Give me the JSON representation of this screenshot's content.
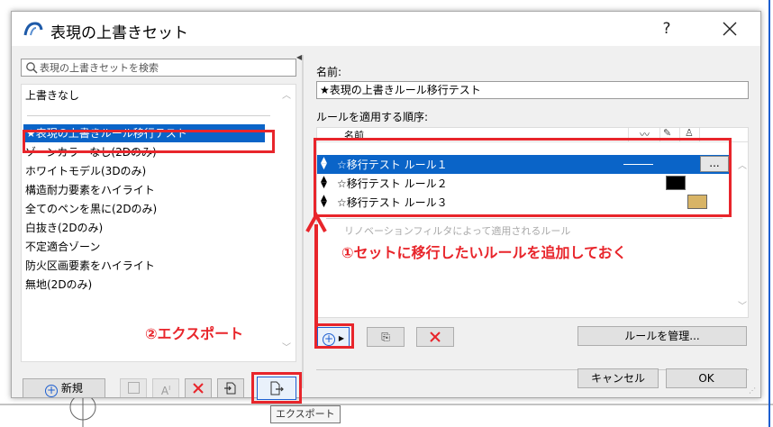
{
  "window": {
    "title": "表現の上書きセット",
    "help_glyph": "?"
  },
  "search": {
    "placeholder": "表現の上書きセットを検索"
  },
  "set_list": {
    "top_item": "上書きなし",
    "items": [
      "★表現の上書きルール移行テスト",
      "ゾーンカラーなし(2Dのみ)",
      "ホワイトモデル(3Dのみ)",
      "構造耐力要素をハイライト",
      "全てのペンを黒に(2Dのみ)",
      "白抜き(2Dのみ)",
      "不定適合ゾーン",
      "防火区画要素をハイライト",
      "無地(2Dのみ)"
    ],
    "selected_index": 0
  },
  "left_toolbar": {
    "new_label": "新規",
    "import_icon": "import-icon",
    "export_icon": "export-icon"
  },
  "details": {
    "name_label": "名前:",
    "name_value": "★表現の上書きルール移行テスト",
    "order_label": "ルールを適用する順序:",
    "col_name": "名前",
    "rules": [
      {
        "label": "☆移行テスト  ルール１",
        "swatch": "line",
        "more": "..."
      },
      {
        "label": "☆移行テスト  ルール２",
        "swatch": "#000000"
      },
      {
        "label": "☆移行テスト  ルール３",
        "swatch": "#d8b466"
      }
    ],
    "faded_text": "リノベーションフィルタによって適用されるルール"
  },
  "right_toolbar": {
    "manage_label": "ルールを管理..."
  },
  "footer": {
    "cancel_label": "キャンセル",
    "ok_label": "OK"
  },
  "annotations": {
    "note1": "①セットに移行したいルールを追加しておく",
    "note2": "②エクスポート"
  },
  "tooltip": "エクスポート",
  "colors": {
    "selection": "#0a64c8",
    "annotation_red": "#e8252b"
  }
}
